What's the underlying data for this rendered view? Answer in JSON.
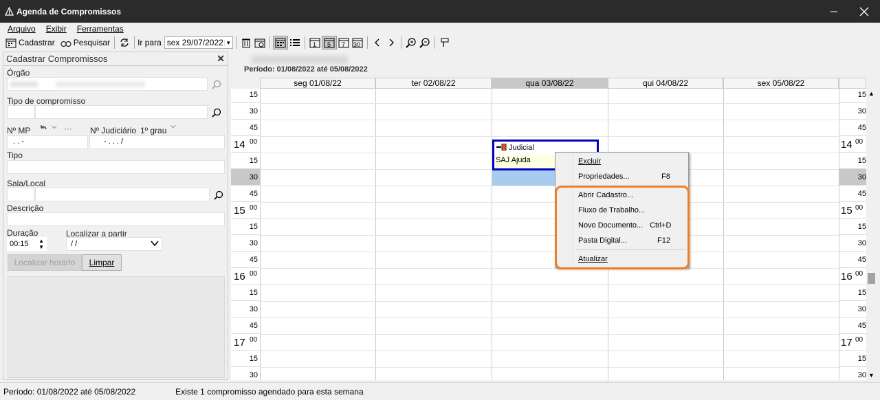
{
  "window": {
    "title": "Agenda de Compromissos",
    "minimize_icon": "minimize-icon",
    "close_icon": "close-icon"
  },
  "menu": {
    "items": [
      "Arquivo",
      "Exibir",
      "Ferramentas"
    ]
  },
  "toolbar": {
    "cadastrar": "Cadastrar",
    "pesquisar": "Pesquisar",
    "ir_para": "Ir para",
    "date_value": "sex 29/07/2022"
  },
  "left_panel": {
    "title": "Cadastrar Compromissos",
    "orgao_label": "Órgão",
    "tipo_compromisso_label": "Tipo de compromisso",
    "nmp_label": "Nº MP",
    "nmp_value": ".    .       -",
    "njudiciario_label": "Nº Judiciário",
    "grau_label": "1º grau",
    "njudiciario_value": "-    .    .    .      /",
    "tipo_label": "Tipo",
    "sala_label": "Sala/Local",
    "descricao_label": "Descrição",
    "duracao_label": "Duração",
    "duracao_value": "00:15",
    "localizar_label": "Localizar a partir",
    "localizar_value": " /  /",
    "localizar_btn": "Localizar horário",
    "limpar_btn": "Limpar"
  },
  "calendar": {
    "period": "Período: 01/08/2022 até 05/08/2022",
    "days": [
      "seg 01/08/22",
      "ter 02/08/22",
      "qua 03/08/22",
      "qui 04/08/22",
      "sex 05/08/22"
    ],
    "rows": [
      {
        "hour": "",
        "min": "15"
      },
      {
        "hour": "",
        "min": "30"
      },
      {
        "hour": "",
        "min": "45"
      },
      {
        "hour": "14",
        "min": "00"
      },
      {
        "hour": "",
        "min": "15"
      },
      {
        "hour": "",
        "min": "30"
      },
      {
        "hour": "",
        "min": "45"
      },
      {
        "hour": "15",
        "min": "00"
      },
      {
        "hour": "",
        "min": "15"
      },
      {
        "hour": "",
        "min": "30"
      },
      {
        "hour": "",
        "min": "45"
      },
      {
        "hour": "16",
        "min": "00"
      },
      {
        "hour": "",
        "min": "15"
      },
      {
        "hour": "",
        "min": "30"
      },
      {
        "hour": "",
        "min": "45"
      },
      {
        "hour": "17",
        "min": "00"
      },
      {
        "hour": "",
        "min": "15"
      },
      {
        "hour": "",
        "min": "30"
      }
    ],
    "appointment": {
      "type": "Judicial",
      "title": "SAJ Ajuda"
    }
  },
  "context_menu": {
    "excluir": "Excluir",
    "propriedades": "Propriedades...",
    "propriedades_key": "F8",
    "abrir": "Abrir Cadastro...",
    "fluxo": "Fluxo de Trabalho...",
    "novo": "Novo Documento...",
    "novo_key": "Ctrl+D",
    "pasta": "Pasta Digital...",
    "pasta_key": "F12",
    "atualizar": "Atualizar"
  },
  "status": {
    "period": "Período: 01/08/2022 até 05/08/2022",
    "message": "Existe 1 compromisso agendado para esta semana"
  },
  "colors": {
    "accent_orange": "#f07d22",
    "appointment_border": "#0000c8",
    "selection": "#a8cbf0"
  }
}
